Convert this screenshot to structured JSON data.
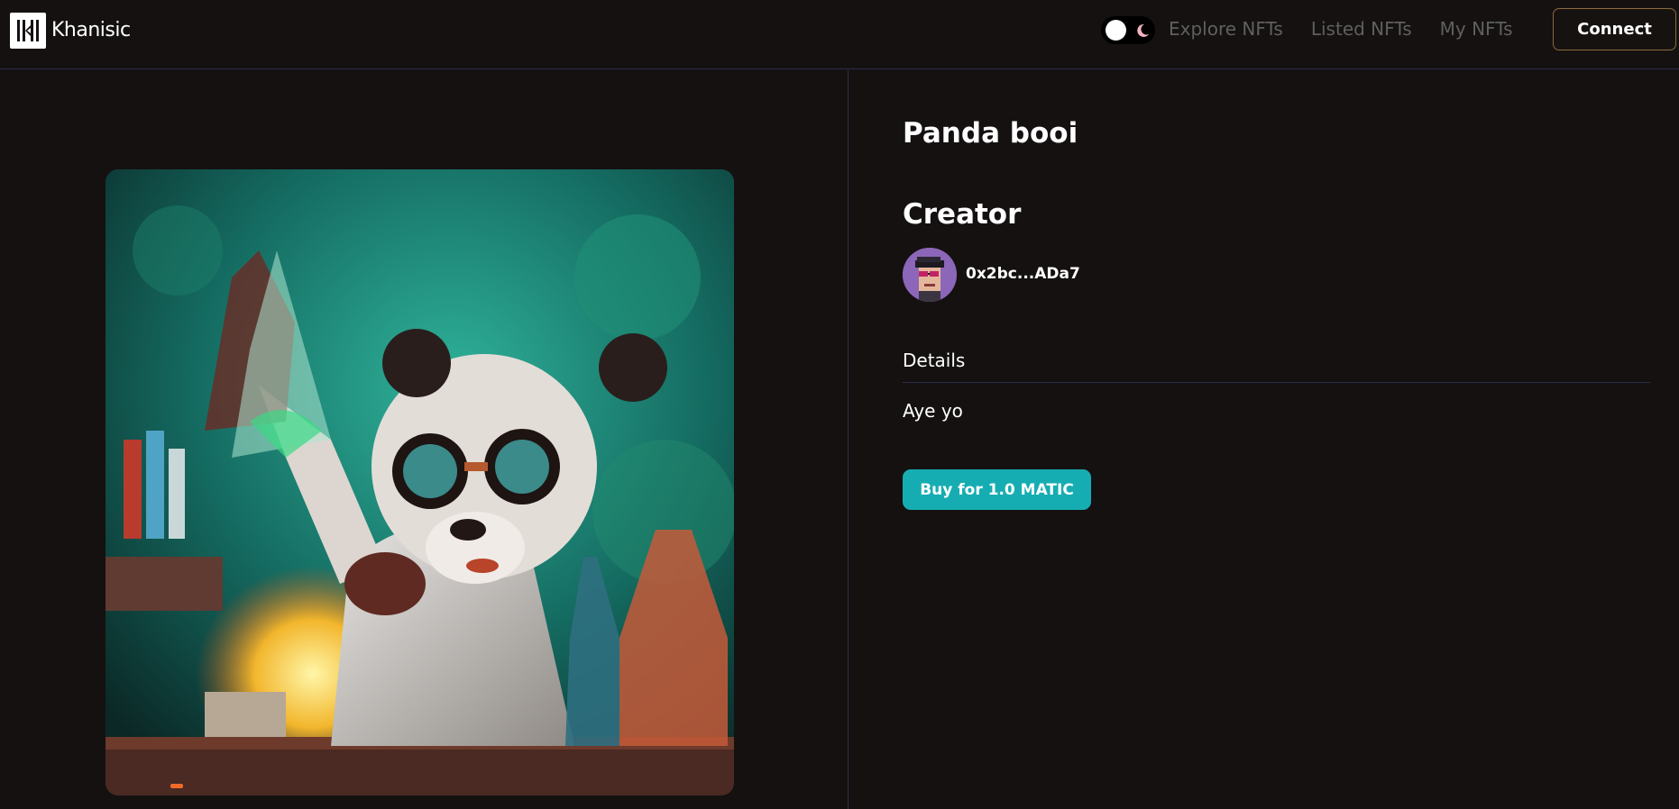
{
  "brand": {
    "name": "Khanisic"
  },
  "nav": {
    "links": [
      "Explore NFTs",
      "Listed NFTs",
      "My NFTs"
    ],
    "connect_label": "Connect"
  },
  "nft": {
    "title": "Panda booi",
    "creator_heading": "Creator",
    "creator_address": "0x2bc...ADa7",
    "details_label": "Details",
    "details_text": "Aye yo",
    "buy_label": "Buy for 1.0 MATIC"
  },
  "colors": {
    "background": "#151111",
    "accent": "#16adb2",
    "nav_link": "#5f5f5f",
    "divider": "#2a2f4a",
    "connect_border": "#8a6a3e"
  },
  "icons": {
    "theme_toggle": "sun-moon-toggle",
    "moon": "moon-icon",
    "avatar": "pixel-punk-avatar"
  }
}
